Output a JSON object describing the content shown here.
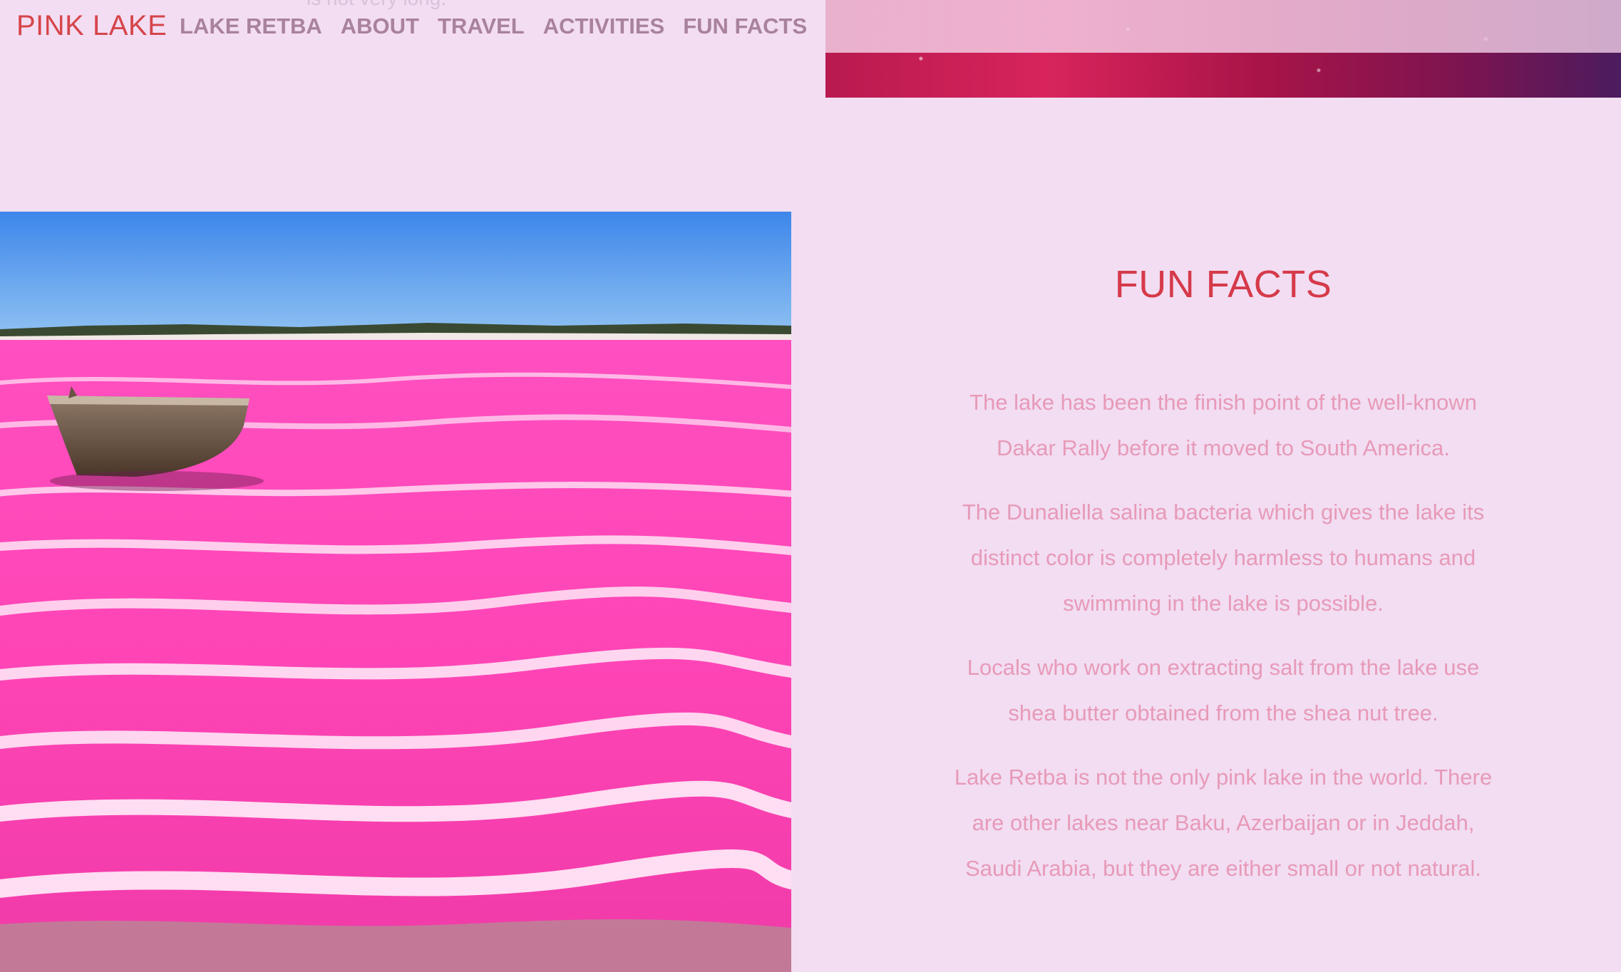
{
  "header": {
    "brand": "PINK LAKE",
    "nav": [
      "LAKE RETBA",
      "ABOUT",
      "TRAVEL",
      "ACTIVITIES",
      "FUN FACTS"
    ],
    "partially_hidden_text": "is not very long."
  },
  "fun_facts": {
    "title": "FUN FACTS",
    "items": [
      "The lake has been the finish point of the well-known Dakar Rally before it moved to South America.",
      "The Dunaliella salina bacteria which gives the lake its distinct color is completely harmless to humans and swimming in the lake is possible.",
      "Locals who work on extracting salt from the lake use shea butter obtained from the shea nut tree.",
      "Lake Retba is not the only pink lake in the world. There are other lakes near Baku, Azerbaijan or in Jeddah, Saudi Arabia, but they are either small or not natural."
    ]
  },
  "images": {
    "top_strip": "pink-lake-water-closeup",
    "main": "pink-lake-with-boat"
  },
  "colors": {
    "background": "#f2ddf2",
    "brand": "#d6454a",
    "nav_link": "#a9829c",
    "heading": "#d63a4a",
    "fact_text": "#e79ab8"
  }
}
